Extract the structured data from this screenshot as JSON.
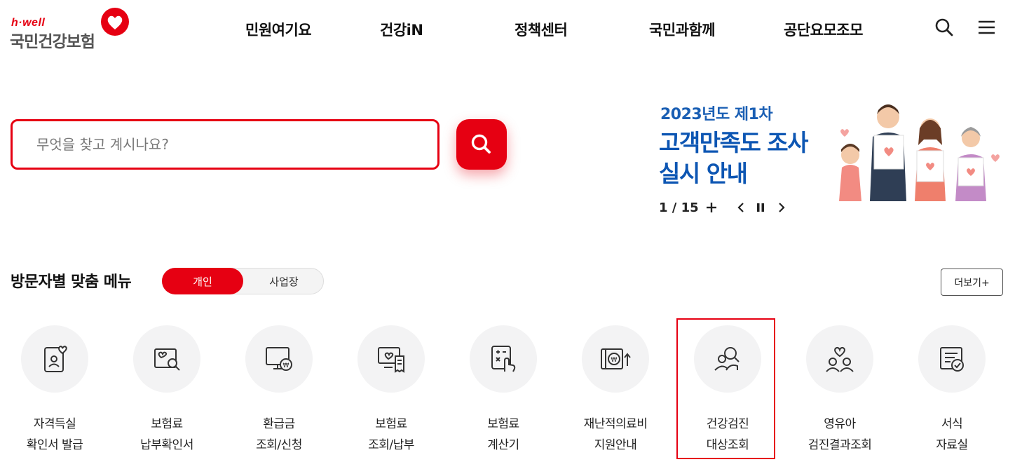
{
  "logo": {
    "tagline": "h·well",
    "name": "국민건강보험"
  },
  "nav": {
    "items": [
      "민원여기요",
      "건강iN",
      "정책센터",
      "국민과함께",
      "공단요모조모"
    ]
  },
  "header_icons": [
    "search-icon",
    "hamburger-menu-icon"
  ],
  "search": {
    "placeholder": "무엇을 찾고 계시나요?",
    "value": ""
  },
  "banner": {
    "line1": "2023년도 제1차",
    "line2": "고객만족도 조사",
    "line3": "실시 안내",
    "pager": "1 / 15",
    "controls": [
      "plus-icon",
      "chevron-left-icon",
      "pause-icon",
      "chevron-right-icon"
    ]
  },
  "section": {
    "title": "방문자별 맞춤 메뉴",
    "toggle": {
      "options": [
        "개인",
        "사업장"
      ],
      "selected": "개인"
    },
    "more_label": "더보기+"
  },
  "menu": [
    {
      "line1": "자격득실",
      "line2": "확인서 발급",
      "icon": "id-card-heart-icon"
    },
    {
      "line1": "보험료",
      "line2": "납부확인서",
      "icon": "document-search-icon"
    },
    {
      "line1": "환급금",
      "line2": "조회/신청",
      "icon": "monitor-won-icon"
    },
    {
      "line1": "보험료",
      "line2": "조회/납부",
      "icon": "monitor-receipt-icon"
    },
    {
      "line1": "보험료",
      "line2": "계산기",
      "icon": "calculator-icon"
    },
    {
      "line1": "재난적의료비",
      "line2": "지원안내",
      "icon": "wallet-won-icon"
    },
    {
      "line1": "건강검진",
      "line2": "대상조회",
      "icon": "people-search-icon",
      "highlighted": true
    },
    {
      "line1": "영유아",
      "line2": "검진결과조회",
      "icon": "family-heart-icon"
    },
    {
      "line1": "서식",
      "line2": "자료실",
      "icon": "form-check-icon"
    }
  ],
  "colors": {
    "brand_red": "#e60012",
    "banner_blue": "#0d56b3",
    "circle_bg": "#f3f3f4"
  }
}
